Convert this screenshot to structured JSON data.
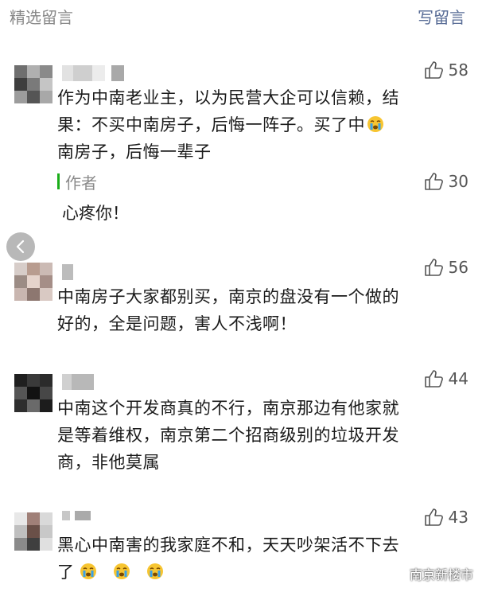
{
  "header": {
    "title": "精选留言",
    "write_comment": "写留言"
  },
  "comments": [
    {
      "likes": "58",
      "text_line1": "作为中南老业主，以为民营大企可以信赖，结",
      "text_line2a": "果：不买中南房子，后悔一阵子。买了中",
      "text_line3": "南房子，后悔一辈子",
      "author_reply": {
        "label": "作者",
        "likes": "30",
        "text": "心疼你！"
      }
    },
    {
      "likes": "56",
      "text_line1": "中南房子大家都别买，南京的盘没有一个做的",
      "text_line2": "好的，全是问题，害人不浅啊！"
    },
    {
      "likes": "44",
      "text_line1": "中南这个开发商真的不行，南京那边有他家就",
      "text_line2": "是等着维权，南京第二个招商级别的垃圾开发",
      "text_line3": "商，非他莫属"
    },
    {
      "likes": "43",
      "text_line1": "黑心中南害的我家庭不和，天天吵架活不下去",
      "text_line2": "了"
    }
  ],
  "watermark": {
    "text": "南京新楼市",
    "icon": "wechat-icon"
  },
  "icons": {
    "like": "thumbs-up-icon",
    "back": "chevron-left-icon",
    "crying": "crying-emoji-icon"
  },
  "colors": {
    "link_blue": "#576b95",
    "author_green": "#1aad19",
    "muted_gray": "#888888"
  }
}
